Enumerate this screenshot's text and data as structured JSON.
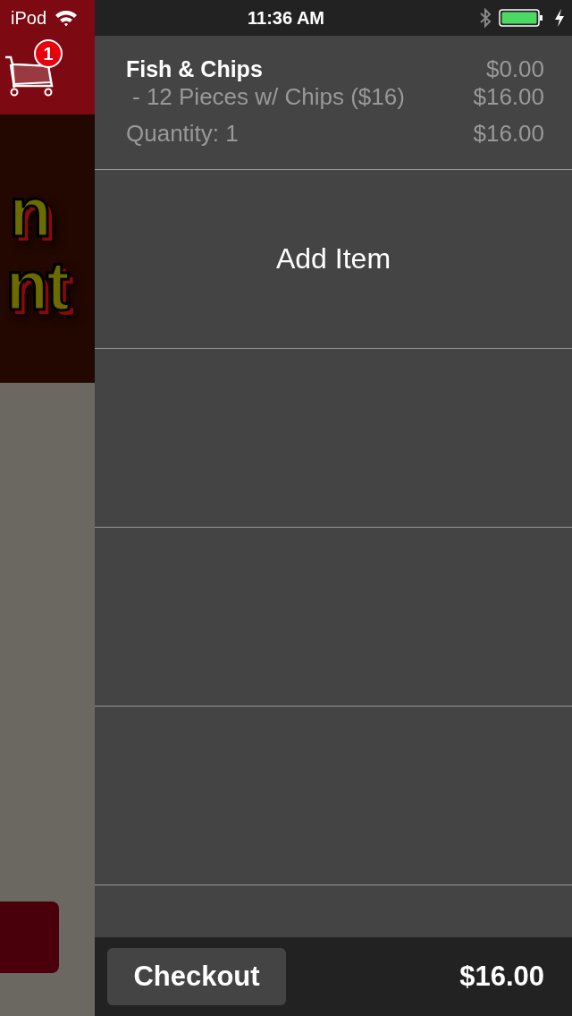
{
  "status_bar": {
    "carrier": "iPod",
    "time": "11:36 AM"
  },
  "cart": {
    "badge": "1"
  },
  "banner": {
    "lines": [
      "n",
      "nt"
    ]
  },
  "order_items": [
    {
      "name": "Fish & Chips",
      "price": "$0.00",
      "options": [
        {
          "label": "- 12 Pieces w/ Chips ($16)",
          "price": "$16.00"
        }
      ],
      "quantity": "Quantity: 1",
      "total": "$16.00"
    }
  ],
  "add_item": {
    "label": "Add Item"
  },
  "checkout": {
    "button": "Checkout",
    "total": "$16.00"
  }
}
